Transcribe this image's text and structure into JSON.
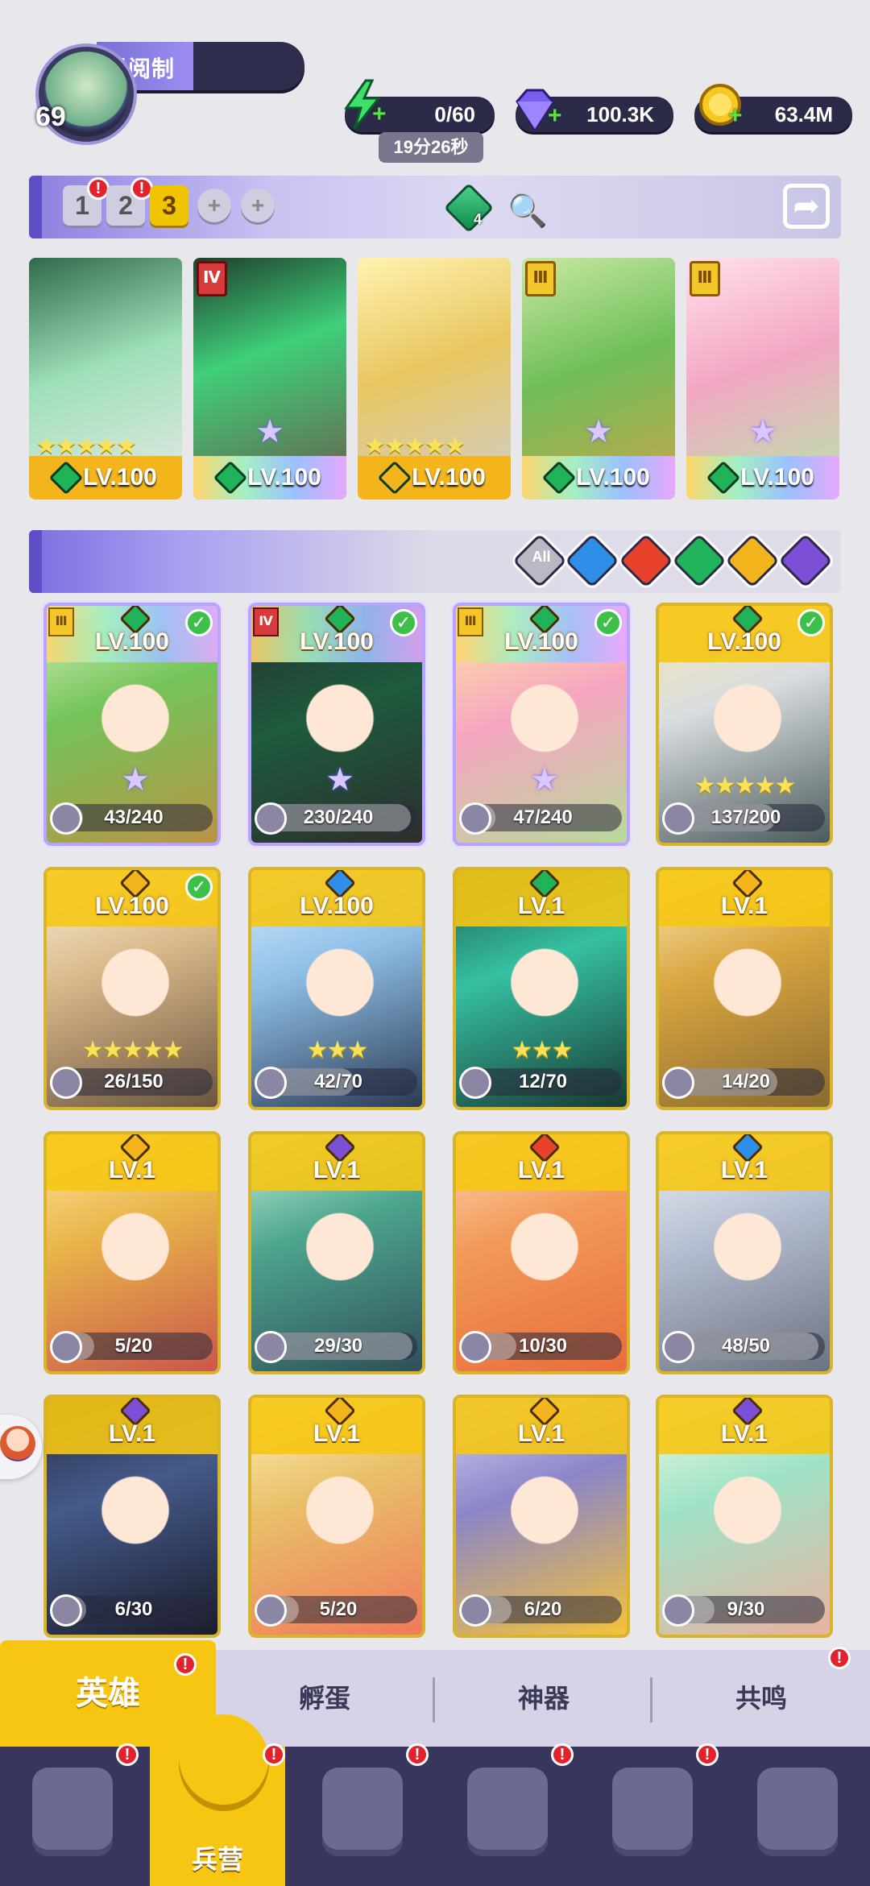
{
  "player": {
    "level": "69",
    "name": "殿阅制"
  },
  "resources": {
    "energy": {
      "value": "0/60",
      "timer": "19分26秒",
      "icon": "lightning-icon"
    },
    "gems": {
      "value": "100.3K",
      "icon": "diamond-icon"
    },
    "gold": {
      "value": "63.4M",
      "icon": "coin-icon"
    }
  },
  "team_bar": {
    "slots": [
      "1",
      "2",
      "3"
    ],
    "add_slots": [
      "+",
      "+"
    ],
    "gem_count": "4",
    "share_icon": "share-icon"
  },
  "team": [
    {
      "level": "LV.100",
      "stars": "★★★★★",
      "rank": "",
      "element": "nature",
      "bg": "#f3b51b"
    },
    {
      "level": "LV.100",
      "stars": "",
      "rank": "Ⅳ",
      "element": "nature",
      "bg": "#8f7ac9"
    },
    {
      "level": "LV.100",
      "stars": "★★★★★",
      "rank": "",
      "element": "light",
      "bg": "#f3b51b"
    },
    {
      "level": "LV.100",
      "stars": "",
      "rank": "Ⅲ",
      "element": "nature",
      "bg": "#8f7ac9"
    },
    {
      "level": "LV.100",
      "stars": "",
      "rank": "Ⅲ",
      "element": "nature",
      "bg": "#8f7ac9"
    }
  ],
  "filters": {
    "all_label": "All",
    "elements": [
      "all",
      "water",
      "fire",
      "nature",
      "light",
      "dark"
    ]
  },
  "heroes": [
    {
      "level": "LV.100",
      "frag": "43/240",
      "ratio": 0.18,
      "element": "nature",
      "rank": "Ⅲ",
      "check": true,
      "owned": true,
      "stars": ""
    },
    {
      "level": "LV.100",
      "frag": "230/240",
      "ratio": 0.96,
      "element": "nature",
      "rank": "Ⅳ",
      "check": true,
      "owned": true,
      "stars": ""
    },
    {
      "level": "LV.100",
      "frag": "47/240",
      "ratio": 0.2,
      "element": "nature",
      "rank": "Ⅲ",
      "check": true,
      "owned": true,
      "stars": ""
    },
    {
      "level": "LV.100",
      "frag": "137/200",
      "ratio": 0.69,
      "element": "nature",
      "rank": "",
      "check": true,
      "owned": false,
      "stars": "★★★★★"
    },
    {
      "level": "LV.100",
      "frag": "26/150",
      "ratio": 0.17,
      "element": "light",
      "rank": "",
      "check": true,
      "owned": false,
      "stars": "★★★★★"
    },
    {
      "level": "LV.100",
      "frag": "42/70",
      "ratio": 0.6,
      "element": "water",
      "rank": "",
      "check": false,
      "owned": false,
      "stars": "★★★"
    },
    {
      "level": "LV.1",
      "frag": "12/70",
      "ratio": 0.17,
      "element": "nature",
      "rank": "",
      "check": false,
      "owned": false,
      "stars": "★★★"
    },
    {
      "level": "LV.1",
      "frag": "14/20",
      "ratio": 0.7,
      "element": "light",
      "rank": "",
      "check": false,
      "owned": false,
      "stars": ""
    },
    {
      "level": "LV.1",
      "frag": "5/20",
      "ratio": 0.25,
      "element": "light",
      "rank": "",
      "check": false,
      "owned": false,
      "stars": ""
    },
    {
      "level": "LV.1",
      "frag": "29/30",
      "ratio": 0.97,
      "element": "dark",
      "rank": "",
      "check": false,
      "owned": false,
      "stars": ""
    },
    {
      "level": "LV.1",
      "frag": "10/30",
      "ratio": 0.33,
      "element": "fire",
      "rank": "",
      "check": false,
      "owned": false,
      "stars": ""
    },
    {
      "level": "LV.1",
      "frag": "48/50",
      "ratio": 0.96,
      "element": "water",
      "rank": "",
      "check": false,
      "owned": false,
      "stars": ""
    },
    {
      "level": "LV.1",
      "frag": "6/30",
      "ratio": 0.2,
      "element": "dark",
      "rank": "",
      "check": false,
      "owned": false,
      "stars": ""
    },
    {
      "level": "LV.1",
      "frag": "5/20",
      "ratio": 0.25,
      "element": "light",
      "rank": "",
      "check": false,
      "owned": false,
      "stars": ""
    },
    {
      "level": "LV.1",
      "frag": "6/20",
      "ratio": 0.3,
      "element": "light",
      "rank": "",
      "check": false,
      "owned": false,
      "stars": ""
    },
    {
      "level": "LV.1",
      "frag": "9/30",
      "ratio": 0.3,
      "element": "dark",
      "rank": "",
      "check": false,
      "owned": false,
      "stars": ""
    }
  ],
  "tabs": [
    "英雄",
    "孵蛋",
    "神器",
    "共鸣"
  ],
  "nav": {
    "active_label": "兵营"
  },
  "colors": {
    "water": "#2f8fe8",
    "fire": "#e8432a",
    "nature": "#21b35a",
    "light": "#f3b51b",
    "dark": "#7b4fd6",
    "all": "#dcdcdc"
  }
}
